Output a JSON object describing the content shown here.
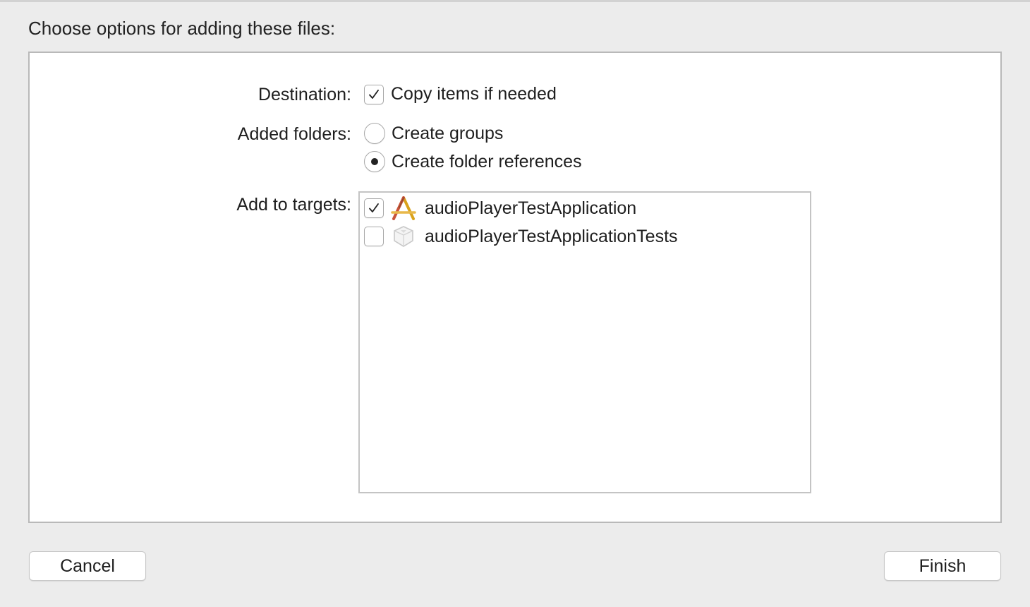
{
  "dialog": {
    "title": "Choose options for adding these files:"
  },
  "destination": {
    "label": "Destination:",
    "copy_items": {
      "label": "Copy items if needed",
      "checked": true
    }
  },
  "added_folders": {
    "label": "Added folders:",
    "options": [
      {
        "label": "Create groups",
        "selected": false
      },
      {
        "label": "Create folder references",
        "selected": true
      }
    ]
  },
  "targets": {
    "label": "Add to targets:",
    "items": [
      {
        "name": "audioPlayerTestApplication",
        "checked": true,
        "icon": "app-target-icon"
      },
      {
        "name": "audioPlayerTestApplicationTests",
        "checked": false,
        "icon": "test-bundle-icon"
      }
    ]
  },
  "buttons": {
    "cancel": "Cancel",
    "finish": "Finish"
  }
}
